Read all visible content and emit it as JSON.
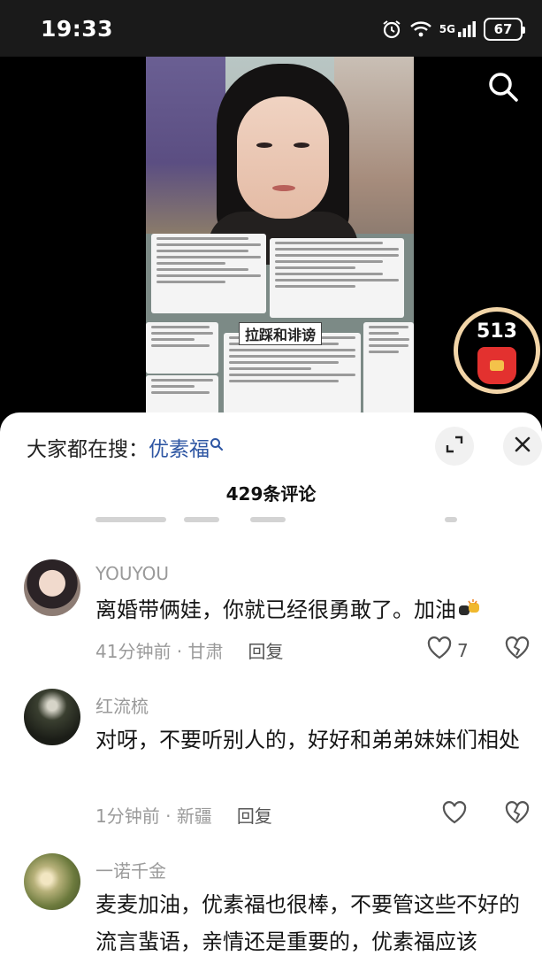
{
  "status_bar": {
    "time": "19:33",
    "network": "5G",
    "battery": "67"
  },
  "video": {
    "overlay_title": "拉踩和诽谤",
    "icons": [
      "search-icon"
    ]
  },
  "redpack": {
    "count": "513",
    "icon": "red-envelope-icon",
    "accent": "#f2d5a8"
  },
  "search_suggest": {
    "prefix": "大家都在搜：",
    "keyword": "优素福"
  },
  "comments_header": {
    "title": "429条评论"
  },
  "comments": [
    {
      "user": "YOUYOU",
      "text": "离婚带俩娃，你就已经很勇敢了。加油",
      "time": "41分钟前",
      "location": "甘肃",
      "reply": "回复",
      "likes": "7"
    },
    {
      "user": "红流梳",
      "text": "对呀，不要听别人的，好好和弟弟妹妹们相处",
      "time": "1分钟前",
      "location": "新疆",
      "reply": "回复",
      "likes": ""
    },
    {
      "user": "一诺千金",
      "text": "麦麦加油，优素福也很棒，不要管这些不好的流言蜚语，亲情还是重要的，优素福应该",
      "time": "",
      "location": "",
      "reply": "",
      "likes": ""
    }
  ],
  "colors": {
    "keyword": "#2e56a3",
    "sheet_bg": "#ffffff",
    "meta_gray": "#9a9a9a"
  }
}
